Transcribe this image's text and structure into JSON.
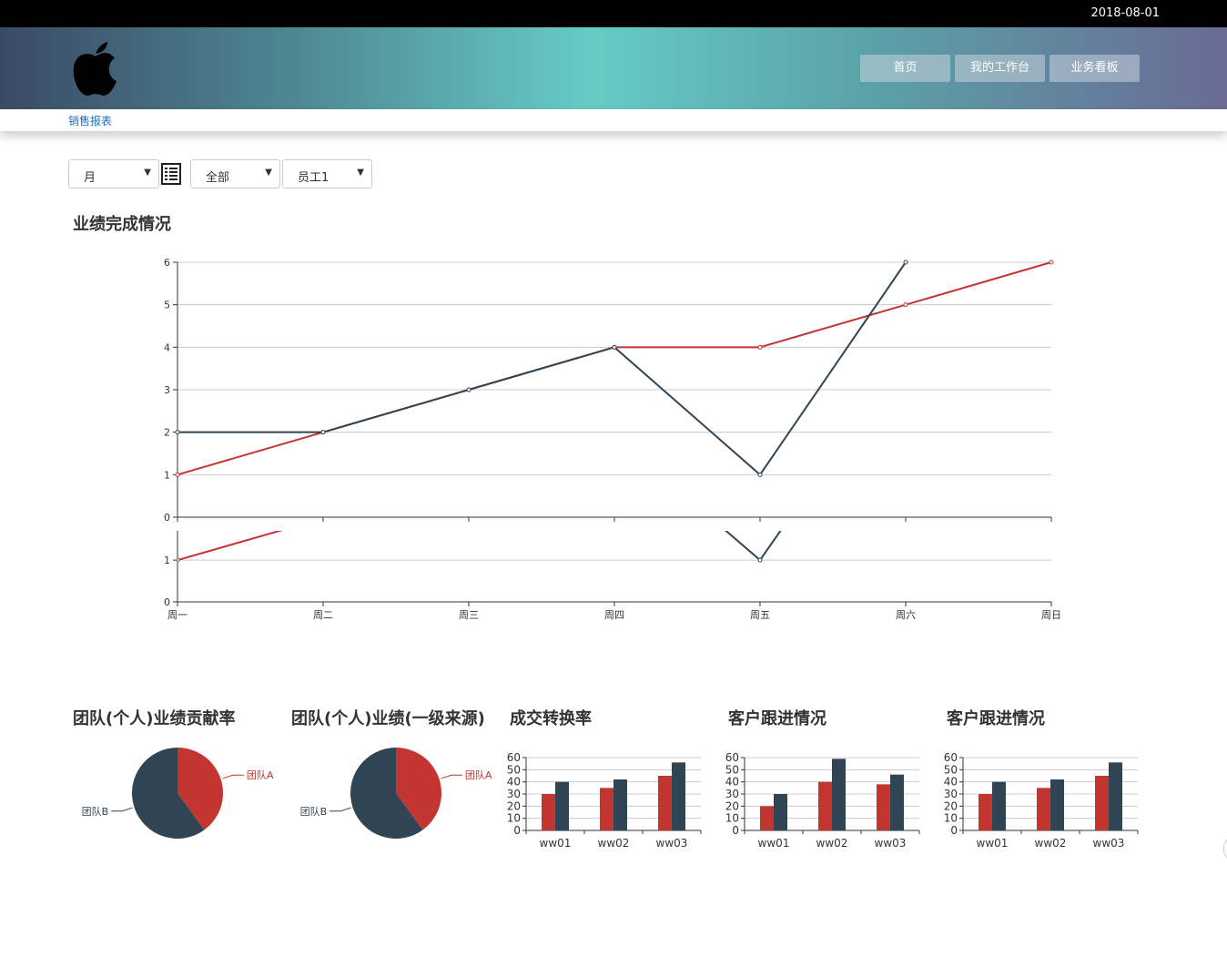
{
  "topbar": {
    "date": "2018-08-01"
  },
  "header": {
    "logo_icon": "apple-logo-icon"
  },
  "nav": [
    {
      "label": "首页"
    },
    {
      "label": "我的工作台"
    },
    {
      "label": "业务看板"
    }
  ],
  "breadcrumb": {
    "label": "销售报表"
  },
  "filters": {
    "period": "月",
    "scope": "全部",
    "employee": "员工1",
    "list_icon": "list-icon"
  },
  "colors": {
    "red": "#c23531",
    "navy": "#2f4554"
  },
  "main_title": "业绩完成情况",
  "chart_data": [
    {
      "type": "line",
      "title": "业绩完成情况",
      "categories": [
        "周一",
        "周二",
        "周三",
        "周四",
        "周五",
        "周六",
        "周日"
      ],
      "ylim": [
        0,
        6
      ],
      "yticks": [
        0,
        1,
        2,
        3,
        4,
        5,
        6
      ],
      "series": [
        {
          "values": [
            1,
            2,
            3,
            4,
            4,
            5,
            6
          ],
          "color": "#c23531"
        },
        {
          "values": [
            2,
            2,
            3,
            4,
            1,
            6,
            null
          ],
          "color": "#2f4554"
        }
      ]
    },
    {
      "type": "pie",
      "title": "团队(个人)业绩贡献率",
      "slices": [
        {
          "label": "团队A",
          "value": 40,
          "color": "#c23531"
        },
        {
          "label": "团队B",
          "value": 60,
          "color": "#2f4554"
        }
      ]
    },
    {
      "type": "pie",
      "title": "团队(个人)业绩(一级来源)",
      "slices": [
        {
          "label": "团队A",
          "value": 40,
          "color": "#c23531"
        },
        {
          "label": "团队B",
          "value": 60,
          "color": "#2f4554"
        }
      ]
    },
    {
      "type": "bar",
      "title": "成交转换率",
      "categories": [
        "ww01",
        "ww02",
        "ww03"
      ],
      "ylim": [
        0,
        60
      ],
      "yticks": [
        0,
        10,
        20,
        30,
        40,
        50,
        60
      ],
      "series": [
        {
          "values": [
            30,
            35,
            45
          ],
          "color": "#c23531"
        },
        {
          "values": [
            40,
            42,
            56
          ],
          "color": "#2f4554"
        }
      ]
    },
    {
      "type": "bar",
      "title": "客户跟进情况",
      "categories": [
        "ww01",
        "ww02",
        "ww03"
      ],
      "ylim": [
        0,
        60
      ],
      "yticks": [
        0,
        10,
        20,
        30,
        40,
        50,
        60
      ],
      "series": [
        {
          "values": [
            20,
            40,
            38
          ],
          "color": "#c23531"
        },
        {
          "values": [
            30,
            59,
            46
          ],
          "color": "#2f4554"
        }
      ]
    },
    {
      "type": "bar",
      "title": "客户跟进情况",
      "categories": [
        "ww01",
        "ww02",
        "ww03"
      ],
      "ylim": [
        0,
        60
      ],
      "yticks": [
        0,
        10,
        20,
        30,
        40,
        50,
        60
      ],
      "series": [
        {
          "values": [
            30,
            35,
            45
          ],
          "color": "#c23531"
        },
        {
          "values": [
            40,
            42,
            56
          ],
          "color": "#2f4554"
        }
      ]
    }
  ]
}
